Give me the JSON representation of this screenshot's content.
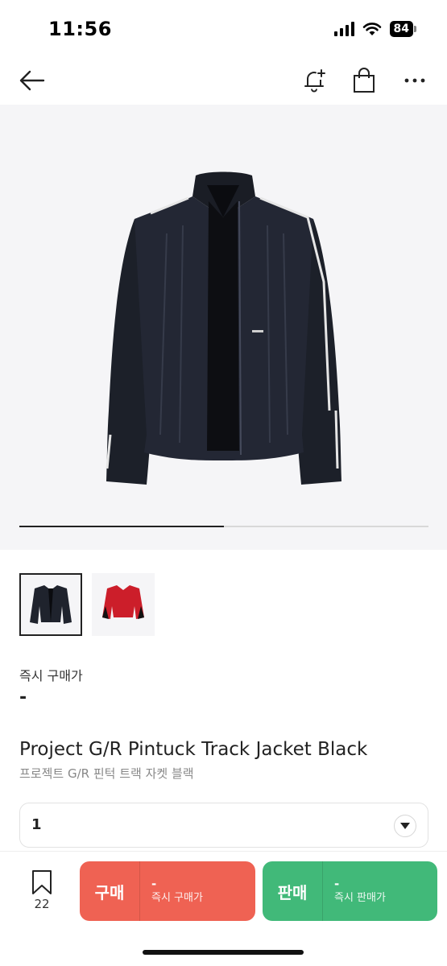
{
  "status": {
    "time": "11:56",
    "battery": "84"
  },
  "nav": {
    "icons": [
      "back-arrow-icon",
      "bell-plus-icon",
      "shopping-bag-icon",
      "more-icon"
    ]
  },
  "hero": {
    "image": "black-track-jacket",
    "carousel_progress": 0.5
  },
  "thumbnails": [
    {
      "image": "black-jacket",
      "selected": true
    },
    {
      "image": "red-jacket",
      "selected": false
    }
  ],
  "price": {
    "label": "즉시 구매가",
    "value": "-"
  },
  "product": {
    "title_en": "Project G/R Pintuck Track Jacket Black",
    "title_ko": "프로젝트 G/R 핀턱 트랙 자켓 블랙"
  },
  "size": {
    "selected": "1"
  },
  "bottom": {
    "wish_count": "22",
    "buy": {
      "label": "구매",
      "price": "-",
      "sub": "즉시 구매가",
      "color": "#ef6253"
    },
    "sell": {
      "label": "판매",
      "price": "-",
      "sub": "즉시 판매가",
      "color": "#41b979"
    }
  }
}
